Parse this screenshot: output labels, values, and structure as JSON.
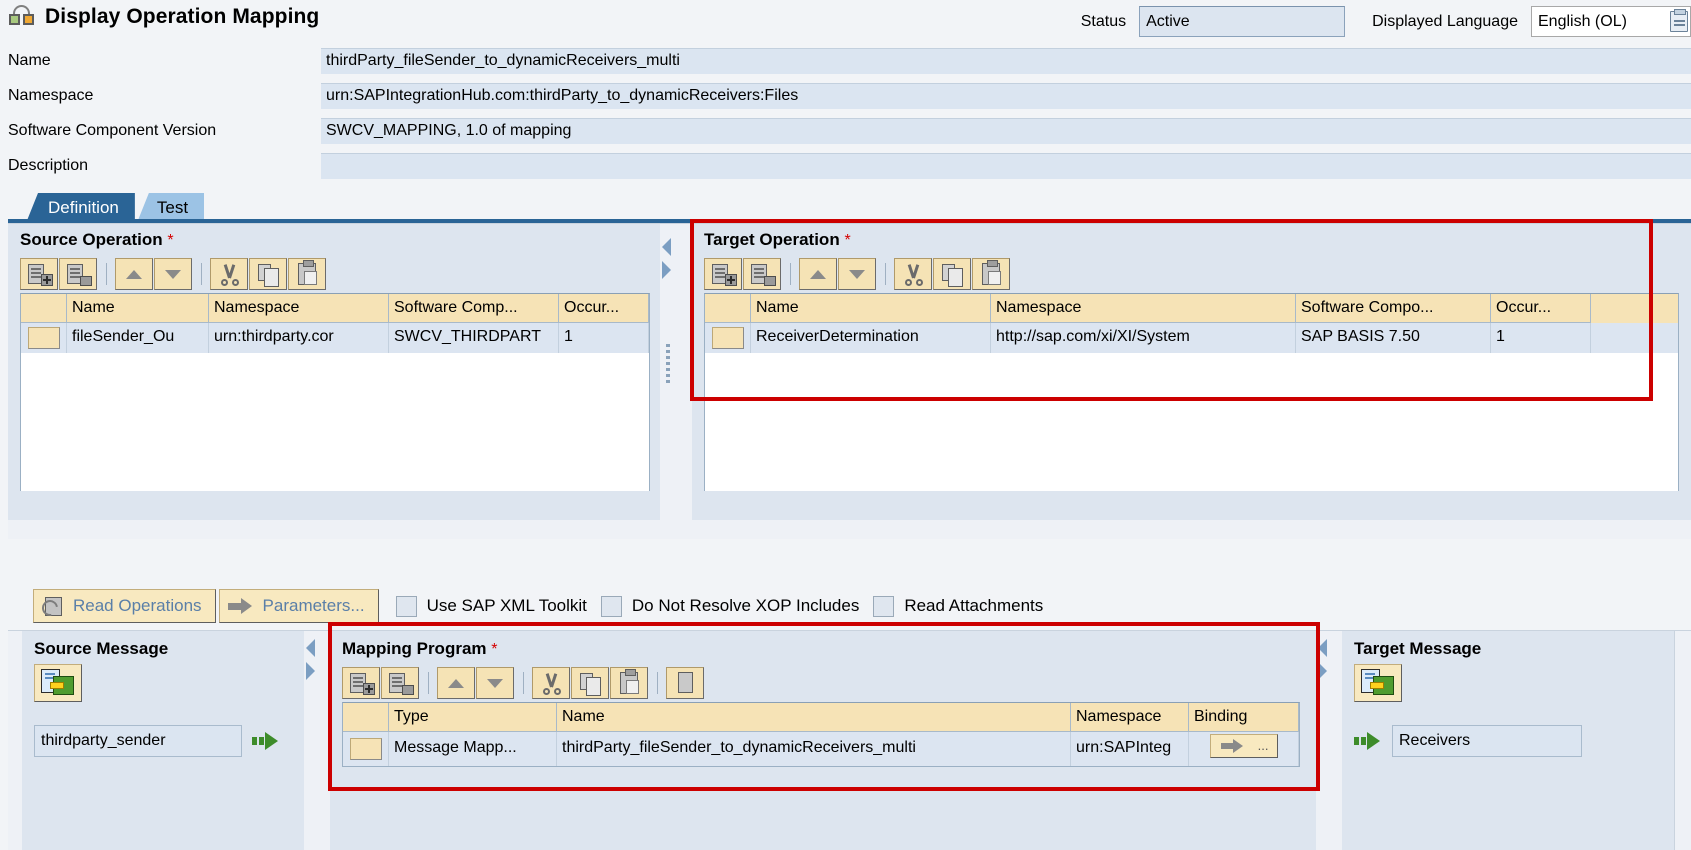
{
  "header": {
    "title": "Display Operation Mapping",
    "app_icon": "operation-mapping-icon",
    "status_label": "Status",
    "status_value": "Active",
    "language_label": "Displayed Language",
    "language_value": "English (OL)"
  },
  "form": {
    "rows": [
      {
        "label": "Name",
        "value": "thirdParty_fileSender_to_dynamicReceivers_multi"
      },
      {
        "label": "Namespace",
        "value": "urn:SAPIntegrationHub.com:thirdParty_to_dynamicReceivers:Files"
      },
      {
        "label": "Software Component Version",
        "value": "SWCV_MAPPING, 1.0 of mapping"
      },
      {
        "label": "Description",
        "value": ""
      }
    ]
  },
  "tabs": [
    {
      "label": "Definition",
      "active": true
    },
    {
      "label": "Test",
      "active": false
    }
  ],
  "source_operation": {
    "title": "Source Operation",
    "required": "*",
    "columns": [
      "",
      "Name",
      "Namespace",
      "Software Comp...",
      "Occur..."
    ],
    "rows": [
      {
        "name": "fileSender_Ou",
        "namespace": "urn:thirdparty.cor",
        "swc": "SWCV_THIRDPART",
        "occurrence": "1"
      }
    ]
  },
  "target_operation": {
    "title": "Target Operation",
    "required": "*",
    "columns": [
      "",
      "Name",
      "Namespace",
      "Software Compo...",
      "Occur..."
    ],
    "rows": [
      {
        "name": "ReceiverDetermination",
        "namespace": "http://sap.com/xi/XI/System",
        "swc": "SAP BASIS 7.50",
        "occurrence": "1"
      }
    ]
  },
  "midbar": {
    "read_operations": "Read Operations",
    "parameters": "Parameters...",
    "checkboxes": [
      {
        "label": "Use SAP XML Toolkit",
        "checked": false
      },
      {
        "label": "Do Not Resolve XOP Includes",
        "checked": false
      },
      {
        "label": "Read Attachments",
        "checked": false
      }
    ]
  },
  "source_message": {
    "title": "Source Message",
    "button_icon": "message-structure-icon",
    "value": "thirdparty_sender",
    "arrow_icon": "green-arrow-icon"
  },
  "mapping_program": {
    "title": "Mapping Program",
    "required": "*",
    "columns": [
      "",
      "Type",
      "Name",
      "Namespace",
      "Binding"
    ],
    "rows": [
      {
        "type": "Message Mapp...",
        "name": "thirdParty_fileSender_to_dynamicReceivers_multi",
        "namespace": "urn:SAPInteg",
        "binding": "binding-button"
      }
    ]
  },
  "target_message": {
    "title": "Target Message",
    "button_icon": "message-structure-icon",
    "value": "Receivers",
    "arrow_icon": "green-arrow-icon"
  },
  "toolbar_icons": [
    "insert-row-icon",
    "delete-row-icon",
    "move-up-icon",
    "move-down-icon",
    "cut-icon",
    "copy-icon",
    "paste-icon"
  ],
  "mapping_toolbar_icons": [
    "insert-row-icon",
    "delete-row-icon",
    "move-up-icon",
    "move-down-icon",
    "cut-icon",
    "copy-icon",
    "paste-icon",
    "display-icon"
  ],
  "colors": {
    "tab_active": "#2a6496",
    "tab_inactive": "#9cc3e5",
    "highlight_box": "#cc0000",
    "panel_bg": "#dde5ef",
    "table_header": "#f6e3b6",
    "field_bg": "#dbe5f1",
    "required_star": "#d40000"
  }
}
